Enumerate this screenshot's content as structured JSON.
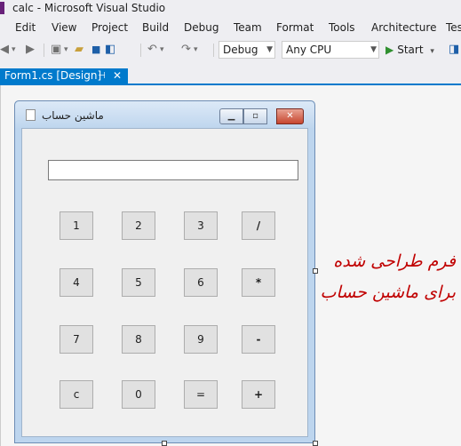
{
  "window": {
    "title": "calc - Microsoft Visual Studio"
  },
  "menu": [
    "Edit",
    "View",
    "Project",
    "Build",
    "Debug",
    "Team",
    "Format",
    "Tools",
    "Architecture",
    "Tes"
  ],
  "toolbar": {
    "config": "Debug",
    "platform": "Any CPU",
    "start_label": "Start"
  },
  "tab": {
    "label": "Form1.cs [Design]"
  },
  "form": {
    "title": "ماشین حساب",
    "display_value": "",
    "buttons": [
      [
        "1",
        "2",
        "3",
        "/"
      ],
      [
        "4",
        "5",
        "6",
        "*"
      ],
      [
        "7",
        "8",
        "9",
        "-"
      ],
      [
        "c",
        "0",
        "=",
        "+"
      ]
    ]
  },
  "annotation": {
    "line1": "فرم طراحی شده",
    "line2": "برای ماشین حساب"
  },
  "colors": {
    "accent": "#007acc",
    "annotation": "#c00000",
    "vs_purple": "#68217a"
  }
}
